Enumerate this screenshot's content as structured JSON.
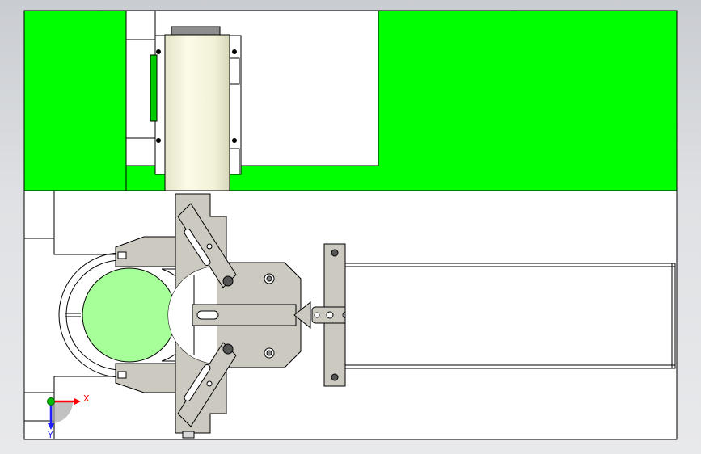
{
  "view": {
    "title": "",
    "background_top": "#c9ccd1",
    "background_bottom": "#e8e9eb"
  },
  "colors": {
    "green_plate": "#00ff00",
    "light_green_part": "#a6ff99",
    "steel_part": "#cbc9c0",
    "cylinder": "#f4f4dc",
    "outline": "#000000",
    "frame": "#ffffff"
  },
  "triad": {
    "x_label": "X",
    "y_label": "Y",
    "x_color": "#ff0000",
    "y_color": "#00aa00",
    "z_color": "#0000ff"
  }
}
